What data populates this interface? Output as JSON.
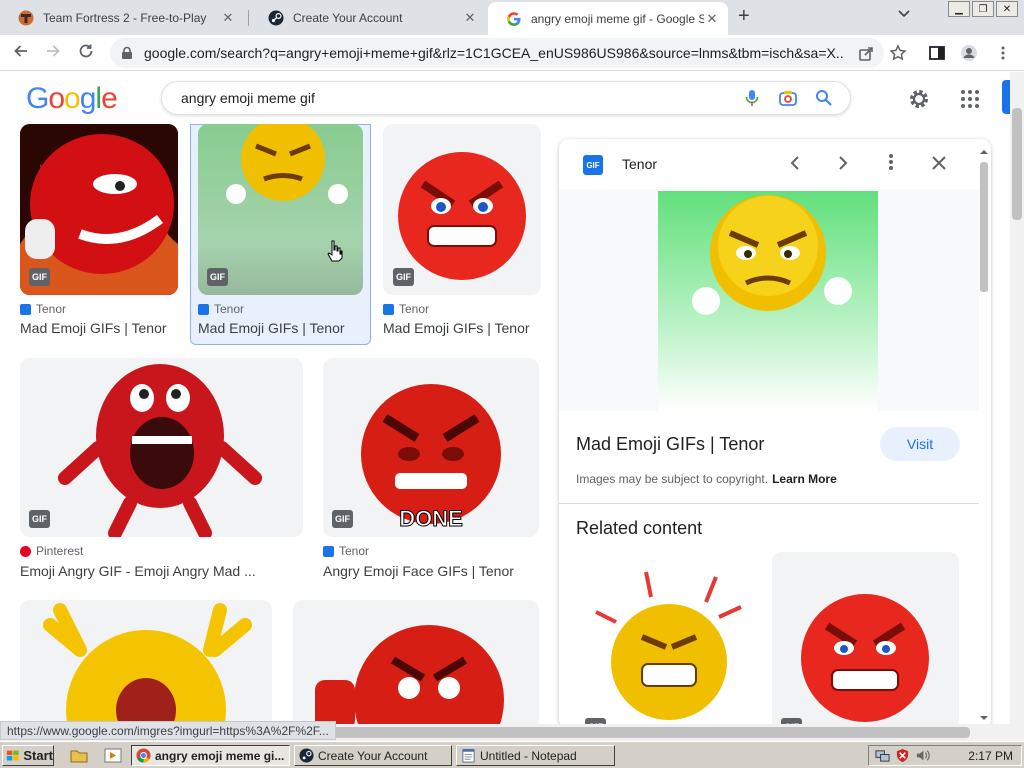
{
  "browser": {
    "tabs": [
      {
        "title": "Team Fortress 2 - Free-to-Play",
        "icon": "tf2-icon"
      },
      {
        "title": "Create Your Account",
        "icon": "steam-icon"
      },
      {
        "title": "angry emoji meme gif - Google S",
        "icon": "google-icon",
        "active": true
      }
    ],
    "new_tab": "+",
    "url_host": "google.com",
    "url_rest": "/search?q=angry+emoji+meme+gif&rlz=1C1GCEA_enUS986US986&source=lnms&tbm=isch&sa=X...",
    "status_url": "https://www.google.com/imgres?imgurl=https%3A%2F%2F..."
  },
  "google": {
    "logo_letters": [
      "G",
      "o",
      "o",
      "g",
      "l",
      "e"
    ],
    "logo_colors": [
      "#4285F4",
      "#EA4335",
      "#FBBC05",
      "#4285F4",
      "#34A853",
      "#EA4335"
    ],
    "query": "angry emoji meme gif"
  },
  "results": [
    {
      "source": "Tenor",
      "title": "Mad Emoji GIFs | Tenor",
      "badge": "GIF"
    },
    {
      "source": "Tenor",
      "title": "Mad Emoji GIFs | Tenor",
      "badge": "GIF"
    },
    {
      "source": "Tenor",
      "title": "Mad Emoji GIFs | Tenor",
      "badge": "GIF"
    },
    {
      "source": "Pinterest",
      "title": "Emoji Angry GIF - Emoji Angry Mad ...",
      "badge": "GIF"
    },
    {
      "source": "Tenor",
      "title": "Angry Emoji Face GIFs | Tenor",
      "badge": "GIF",
      "caption": "DONE"
    }
  ],
  "panel": {
    "source_badge": "GIF",
    "source": "Tenor",
    "title": "Mad Emoji GIFs | Tenor",
    "visit": "Visit",
    "copyright": "Images may be subject to copyright.",
    "learn_more": "Learn More",
    "related": "Related content",
    "related_badge": "GIF"
  },
  "taskbar": {
    "start": "Start",
    "buttons": [
      {
        "label": "angry emoji meme gi...",
        "icon": "chrome-icon",
        "active": true
      },
      {
        "label": "Create Your Account",
        "icon": "steam-icon"
      },
      {
        "label": "Untitled - Notepad",
        "icon": "notepad-icon"
      }
    ],
    "clock": "2:17 PM"
  }
}
